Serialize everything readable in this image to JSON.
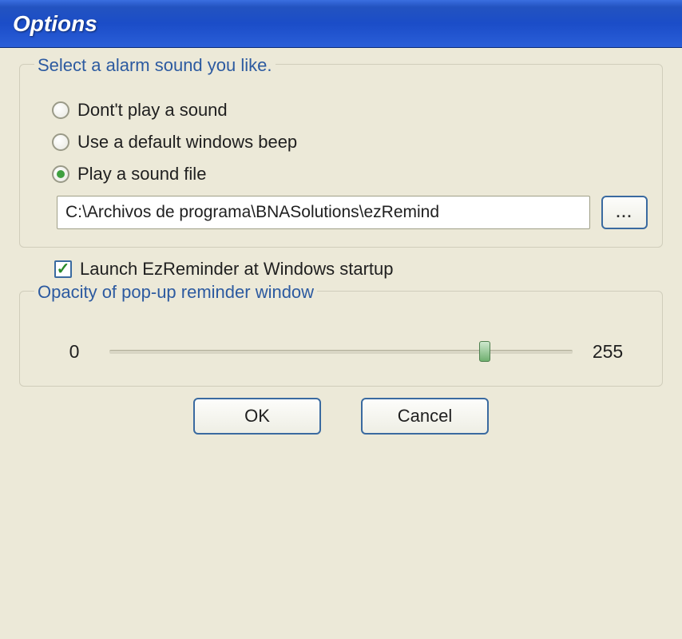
{
  "title": "Options",
  "sound_group": {
    "legend": "Select a alarm sound you like.",
    "options": {
      "no_sound": "Dont't play a sound",
      "default_beep": "Use a default windows beep",
      "sound_file": "Play a sound file"
    },
    "selected": "sound_file",
    "file_path": "C:\\Archivos de programa\\BNASolutions\\ezRemind",
    "browse_label": "..."
  },
  "startup": {
    "label": "Launch EzReminder at Windows startup",
    "checked": true
  },
  "opacity_group": {
    "legend": "Opacity of pop-up reminder window",
    "min_label": "0",
    "max_label": "255"
  },
  "buttons": {
    "ok": "OK",
    "cancel": "Cancel"
  }
}
